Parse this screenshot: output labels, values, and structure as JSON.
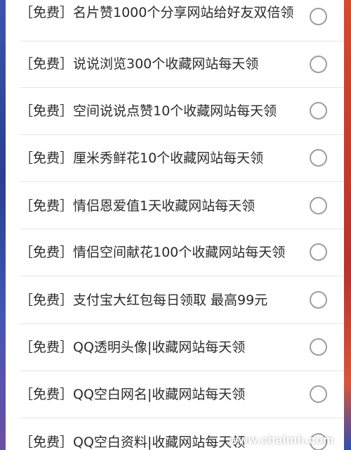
{
  "options": [
    {
      "label": "［免费］名片赞1000个分享网站给好友双倍领"
    },
    {
      "label": "［免费］说说浏览300个收藏网站每天领"
    },
    {
      "label": "［免费］空间说说点赞10个收藏网站每天领"
    },
    {
      "label": "［免费］厘米秀鲜花10个收藏网站每天领"
    },
    {
      "label": "［免费］情侣恩爱值1天收藏网站每天领"
    },
    {
      "label": "［免费］情侣空间献花100个收藏网站每天领"
    },
    {
      "label": "［免费］支付宝大红包每日领取 最高99元"
    },
    {
      "label": "［免费］QQ透明头像|收藏网站每天领"
    },
    {
      "label": "［免费］QQ空白网名|收藏网站每天领"
    },
    {
      "label": "［免费］QQ空白资料|收藏网站每天领"
    }
  ],
  "watermark": "www.chalmh.com",
  "colors": {
    "radio_border": "#9e9e9e",
    "divider": "#e6e6e6",
    "text": "#2b2b2b"
  }
}
